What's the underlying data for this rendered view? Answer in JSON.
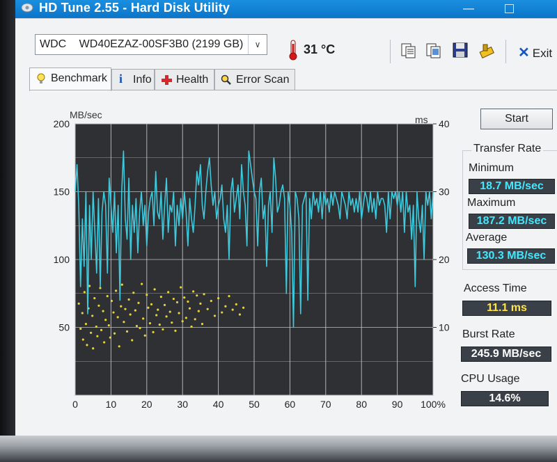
{
  "window": {
    "title": "HD Tune 2.55 - Hard Disk Utility",
    "minimize_icon": "minimize-icon",
    "maximize_icon": "maximize-icon"
  },
  "toolbar": {
    "drive": "WDC WD40EZAZ-00SF3B0 (2199 GB)",
    "drive_brand": "WDC",
    "drive_model": "WD40EZAZ-00SF3B0 (2199 GB)",
    "temperature": "31 °C",
    "exit_label": "Exit",
    "icons": [
      "copy-text-icon",
      "copy-screenshot-icon",
      "save-icon",
      "options-icon"
    ]
  },
  "tabs": [
    {
      "label": "Benchmark",
      "icon": "lightbulb-icon",
      "active": true
    },
    {
      "label": "Info",
      "icon": "info-icon",
      "active": false
    },
    {
      "label": "Health",
      "icon": "health-cross-icon",
      "active": false
    },
    {
      "label": "Error Scan",
      "icon": "magnifier-icon",
      "active": false
    }
  ],
  "benchmark": {
    "start_label": "Start",
    "transfer_rate_title": "Transfer Rate",
    "minimum_label": "Minimum",
    "minimum_value": "18.7 MB/sec",
    "maximum_label": "Maximum",
    "maximum_value": "187.2 MB/sec",
    "average_label": "Average",
    "average_value": "130.3 MB/sec",
    "access_time_label": "Access Time",
    "access_time_value": "11.1 ms",
    "burst_rate_label": "Burst Rate",
    "burst_rate_value": "245.9 MB/sec",
    "cpu_usage_label": "CPU Usage",
    "cpu_usage_value": "14.6%"
  },
  "chart_data": {
    "type": "line",
    "ylabel": "MB/sec",
    "y2label": "ms",
    "xlim": [
      0,
      100
    ],
    "ylim": [
      0,
      200
    ],
    "y2lim": [
      0,
      40
    ],
    "x_ticks": [
      "0",
      "10",
      "20",
      "30",
      "40",
      "50",
      "60",
      "70",
      "80",
      "90",
      "100%"
    ],
    "y_ticks": [
      "200",
      "150",
      "100",
      "50"
    ],
    "y2_ticks": [
      "40",
      "30",
      "20",
      "10"
    ],
    "grid": true,
    "colors": {
      "transfer": "#3ec9dc",
      "access": "#e8d23a",
      "background": "#2e3033",
      "grid": "#c8cacc"
    },
    "series": [
      {
        "kind": "transfer-rate",
        "x": [
          0,
          0.5,
          1,
          1.5,
          2,
          2.5,
          3,
          3.5,
          4,
          4.5,
          5,
          5.5,
          6,
          6.5,
          7,
          7.5,
          8,
          8.5,
          9,
          9.5,
          10,
          10.5,
          11,
          11.5,
          12,
          12.5,
          13,
          13.5,
          14,
          14.5,
          15,
          15.5,
          16,
          16.5,
          17,
          17.5,
          18,
          18.5,
          19,
          19.5,
          20,
          20.5,
          21,
          21.5,
          22,
          22.5,
          23,
          23.5,
          24,
          24.5,
          25,
          25.5,
          26,
          26.5,
          27,
          27.5,
          28,
          28.5,
          29,
          29.5,
          30,
          30.5,
          31,
          31.5,
          32,
          32.5,
          33,
          33.5,
          34,
          34.5,
          35,
          35.5,
          36,
          36.5,
          37,
          37.5,
          38,
          38.5,
          39,
          39.5,
          40,
          40.5,
          41,
          41.5,
          42,
          42.5,
          43,
          43.5,
          44,
          44.5,
          45,
          45.5,
          46,
          46.5,
          47,
          47.5,
          48,
          48.5,
          49,
          49.5,
          50,
          50.5,
          51,
          51.5,
          52,
          52.5,
          53,
          53.5,
          54,
          54.5,
          55,
          55.5,
          56,
          56.5,
          57,
          57.5,
          58,
          58.5,
          59,
          59.5,
          60,
          60.5,
          61,
          61.5,
          62,
          62.5,
          63,
          63.5,
          64,
          64.5,
          65,
          65.5,
          66,
          66.5,
          67,
          67.5,
          68,
          68.5,
          69,
          69.5,
          70,
          70.5,
          71,
          71.5,
          72,
          72.5,
          73,
          73.5,
          74,
          74.5,
          75,
          75.5,
          76,
          76.5,
          77,
          77.5,
          78,
          78.5,
          79,
          79.5,
          80,
          80.5,
          81,
          81.5,
          82,
          82.5,
          83,
          83.5,
          84,
          84.5,
          85,
          85.5,
          86,
          86.5,
          87,
          87.5,
          88,
          88.5,
          89,
          89.5,
          90,
          90.5,
          91,
          91.5,
          92,
          92.5,
          93,
          93.5,
          94,
          94.5,
          95,
          95.5,
          96,
          96.5,
          97,
          97.5,
          98,
          98.5,
          99,
          99.5,
          100
        ],
        "y": [
          150,
          170,
          140,
          80,
          130,
          95,
          150,
          60,
          140,
          100,
          150,
          120,
          90,
          145,
          80,
          135,
          150,
          140,
          90,
          160,
          140,
          120,
          150,
          105,
          140,
          70,
          150,
          180,
          130,
          115,
          160,
          100,
          140,
          120,
          145,
          105,
          135,
          150,
          125,
          140,
          110,
          135,
          145,
          150,
          125,
          165,
          135,
          130,
          150,
          115,
          140,
          160,
          120,
          140,
          135,
          150,
          110,
          140,
          125,
          145,
          130,
          150,
          135,
          110,
          145,
          130,
          120,
          140,
          165,
          155,
          170,
          140,
          130,
          150,
          165,
          175,
          155,
          140,
          150,
          130,
          140,
          145,
          155,
          130,
          120,
          140,
          100,
          150,
          160,
          135,
          145,
          155,
          130,
          170,
          150,
          140,
          110,
          180,
          170,
          160,
          150,
          145,
          110,
          150,
          160,
          130,
          140,
          95,
          140,
          150,
          120,
          175,
          160,
          135,
          140,
          150,
          155,
          145,
          75,
          150,
          140,
          120,
          50,
          150,
          145,
          130,
          60,
          140,
          145,
          150,
          70,
          145,
          130,
          150,
          140,
          145,
          135,
          150,
          130,
          150,
          140,
          145,
          135,
          150,
          140,
          150,
          145,
          140,
          130,
          150,
          145,
          140,
          130,
          150,
          140,
          145,
          135,
          145,
          135,
          150,
          130,
          140,
          150,
          145,
          135,
          150,
          135,
          145,
          130,
          150,
          140,
          145,
          145,
          140,
          120,
          150,
          130,
          150,
          145,
          150,
          140,
          150,
          135,
          150,
          120,
          150,
          135,
          140,
          115,
          140,
          80,
          150,
          130,
          120,
          140,
          100,
          150,
          140,
          150,
          130,
          150
        ]
      },
      {
        "kind": "access-time",
        "x": [
          1,
          1.5,
          2,
          2.2,
          2.6,
          3,
          3.3,
          3.7,
          4,
          4.4,
          4.8,
          5,
          5.4,
          5.9,
          6.2,
          6.6,
          7,
          7.3,
          7.8,
          8.1,
          8.5,
          9,
          9.4,
          9.8,
          10.2,
          10.7,
          11,
          11.4,
          11.9,
          12.3,
          12.8,
          13.1,
          13.6,
          14,
          14.5,
          15,
          15.4,
          15.9,
          16.3,
          16.8,
          17.2,
          17.7,
          18.1,
          18.6,
          19,
          19.5,
          20,
          20.4,
          20.9,
          21.3,
          21.8,
          22.2,
          22.7,
          23.1,
          23.6,
          24,
          24.5,
          25,
          25.5,
          26,
          26.5,
          27,
          27.5,
          28,
          28.5,
          29,
          29.5,
          30,
          30.5,
          31,
          31.5,
          32,
          32.5,
          33,
          33.5,
          34,
          34.5,
          35,
          35.5,
          36,
          37,
          38,
          39,
          40,
          41,
          42,
          43,
          44,
          45,
          46,
          47
        ],
        "y": [
          13.5,
          9.8,
          12.1,
          8.2,
          15.2,
          10.5,
          7.4,
          12.8,
          16.1,
          9.2,
          11.7,
          6.9,
          14.3,
          10.1,
          8.7,
          13.2,
          15.8,
          9.6,
          12.4,
          7.8,
          11.1,
          14.6,
          10.3,
          8.5,
          13.9,
          12.2,
          9.1,
          15.4,
          11.5,
          7.2,
          13.1,
          16.3,
          10.8,
          12.7,
          9.4,
          14.1,
          11.9,
          8.1,
          15.1,
          12.5,
          10.2,
          13.6,
          9.9,
          16.4,
          11.3,
          8.8,
          14.8,
          12.9,
          10.6,
          13.4,
          9.3,
          15.6,
          11.8,
          12.6,
          10.4,
          14.5,
          9.7,
          13.3,
          11.6,
          15.2,
          12.3,
          10.7,
          14.2,
          9.5,
          13.7,
          12.1,
          15.9,
          10.9,
          14.4,
          11.4,
          13.8,
          12.8,
          10.1,
          15.3,
          11.2,
          14.7,
          12.4,
          13.5,
          10.5,
          14.9,
          12.7,
          13.9,
          11.7,
          14.3,
          12.2,
          13.1,
          14.6,
          12.6,
          13.4,
          11.9,
          12.9
        ]
      }
    ]
  }
}
